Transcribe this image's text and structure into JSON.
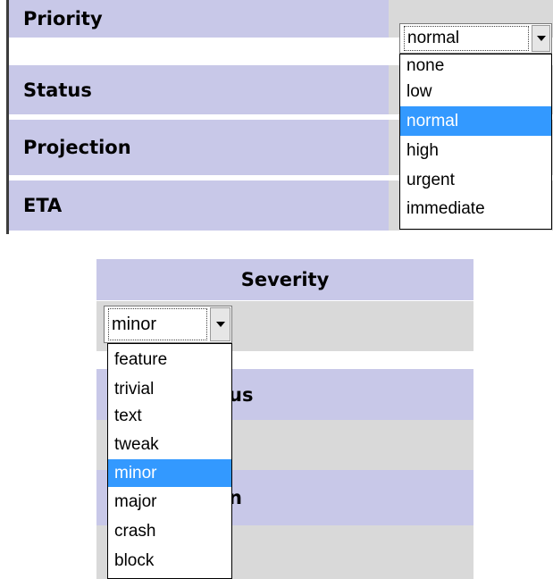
{
  "top_table": {
    "rows": [
      {
        "label": "Priority"
      },
      {
        "label": "Status"
      },
      {
        "label": "Projection"
      },
      {
        "label": "ETA"
      }
    ],
    "priority_select": {
      "value": "normal",
      "options": [
        "none",
        "low",
        "normal",
        "high",
        "urgent",
        "immediate"
      ],
      "selected_index": 2
    }
  },
  "bottom_table": {
    "header": "Severity",
    "severity_select": {
      "value": "minor",
      "options": [
        "feature",
        "trivial",
        "text",
        "tweak",
        "minor",
        "major",
        "crash",
        "block"
      ],
      "selected_index": 4
    },
    "partial_labels": {
      "row1_suffix": "us",
      "row2_suffix": "n"
    }
  },
  "colors": {
    "label_bg": "#c8c8e8",
    "value_bg": "#d9d9d9",
    "highlight": "#3399ff"
  }
}
